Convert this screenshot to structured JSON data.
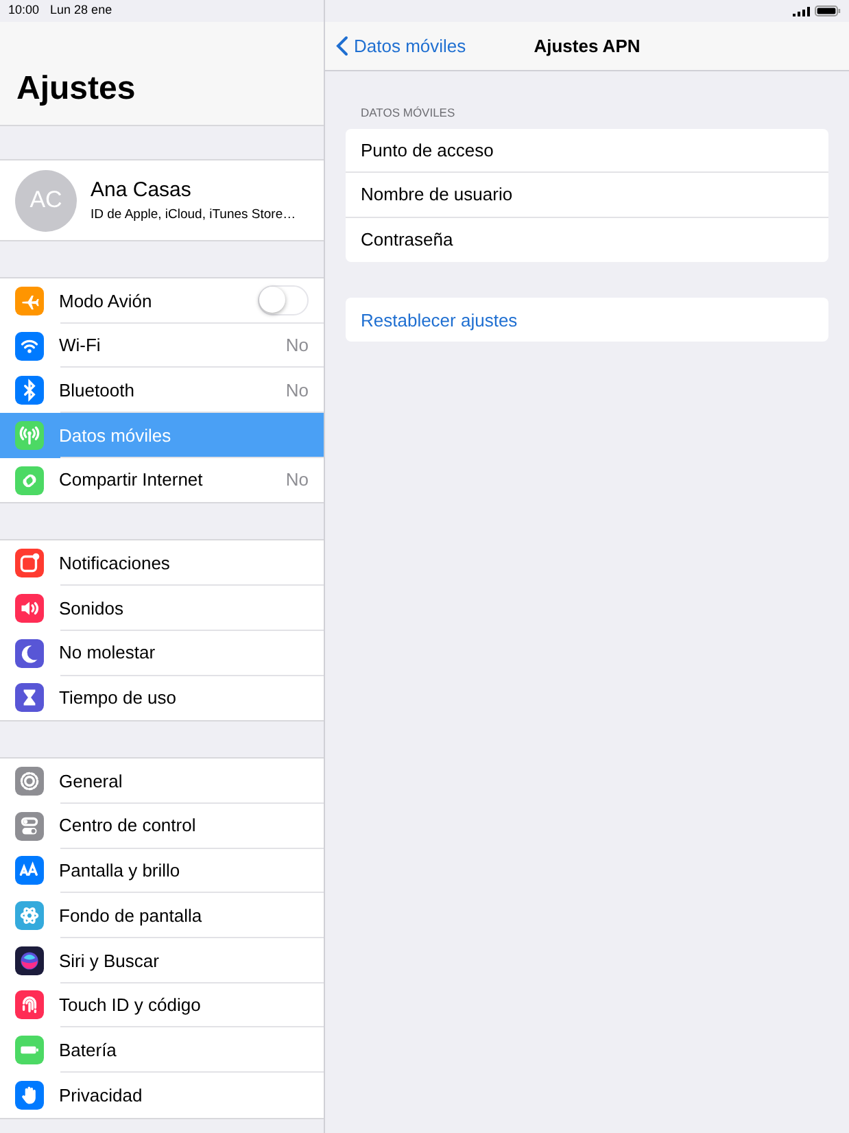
{
  "status_bar": {
    "time": "10:00",
    "date": "Lun 28 ene"
  },
  "sidebar": {
    "title": "Ajustes",
    "profile": {
      "initials": "AC",
      "name": "Ana Casas",
      "subtitle": "ID de Apple, iCloud, iTunes Store…"
    },
    "groups": [
      {
        "items": [
          {
            "label": "Modo Avión",
            "kind": "switch",
            "on": false,
            "selected": false
          },
          {
            "label": "Wi-Fi",
            "kind": "value",
            "value": "No",
            "selected": false
          },
          {
            "label": "Bluetooth",
            "kind": "value",
            "value": "No",
            "selected": false
          },
          {
            "label": "Datos móviles",
            "kind": "plain",
            "selected": true
          },
          {
            "label": "Compartir Internet",
            "kind": "value",
            "value": "No",
            "selected": false
          }
        ]
      },
      {
        "items": [
          {
            "label": "Notificaciones",
            "kind": "plain",
            "selected": false
          },
          {
            "label": "Sonidos",
            "kind": "plain",
            "selected": false
          },
          {
            "label": "No molestar",
            "kind": "plain",
            "selected": false
          },
          {
            "label": "Tiempo de uso",
            "kind": "plain",
            "selected": false
          }
        ]
      },
      {
        "items": [
          {
            "label": "General",
            "kind": "plain",
            "selected": false
          },
          {
            "label": "Centro de control",
            "kind": "plain",
            "selected": false
          },
          {
            "label": "Pantalla y brillo",
            "kind": "plain",
            "selected": false
          },
          {
            "label": "Fondo de pantalla",
            "kind": "plain",
            "selected": false
          },
          {
            "label": "Siri y Buscar",
            "kind": "plain",
            "selected": false
          },
          {
            "label": "Touch ID y código",
            "kind": "plain",
            "selected": false
          },
          {
            "label": "Batería",
            "kind": "plain",
            "selected": false
          },
          {
            "label": "Privacidad",
            "kind": "plain",
            "selected": false
          }
        ]
      }
    ]
  },
  "detail": {
    "back": "Datos móviles",
    "title": "Ajustes APN",
    "section_header": "DATOS MÓVILES",
    "fields": [
      {
        "label": "Punto de acceso"
      },
      {
        "label": "Nombre de usuario"
      },
      {
        "label": "Contraseña"
      }
    ],
    "reset": "Restablecer ajustes"
  }
}
